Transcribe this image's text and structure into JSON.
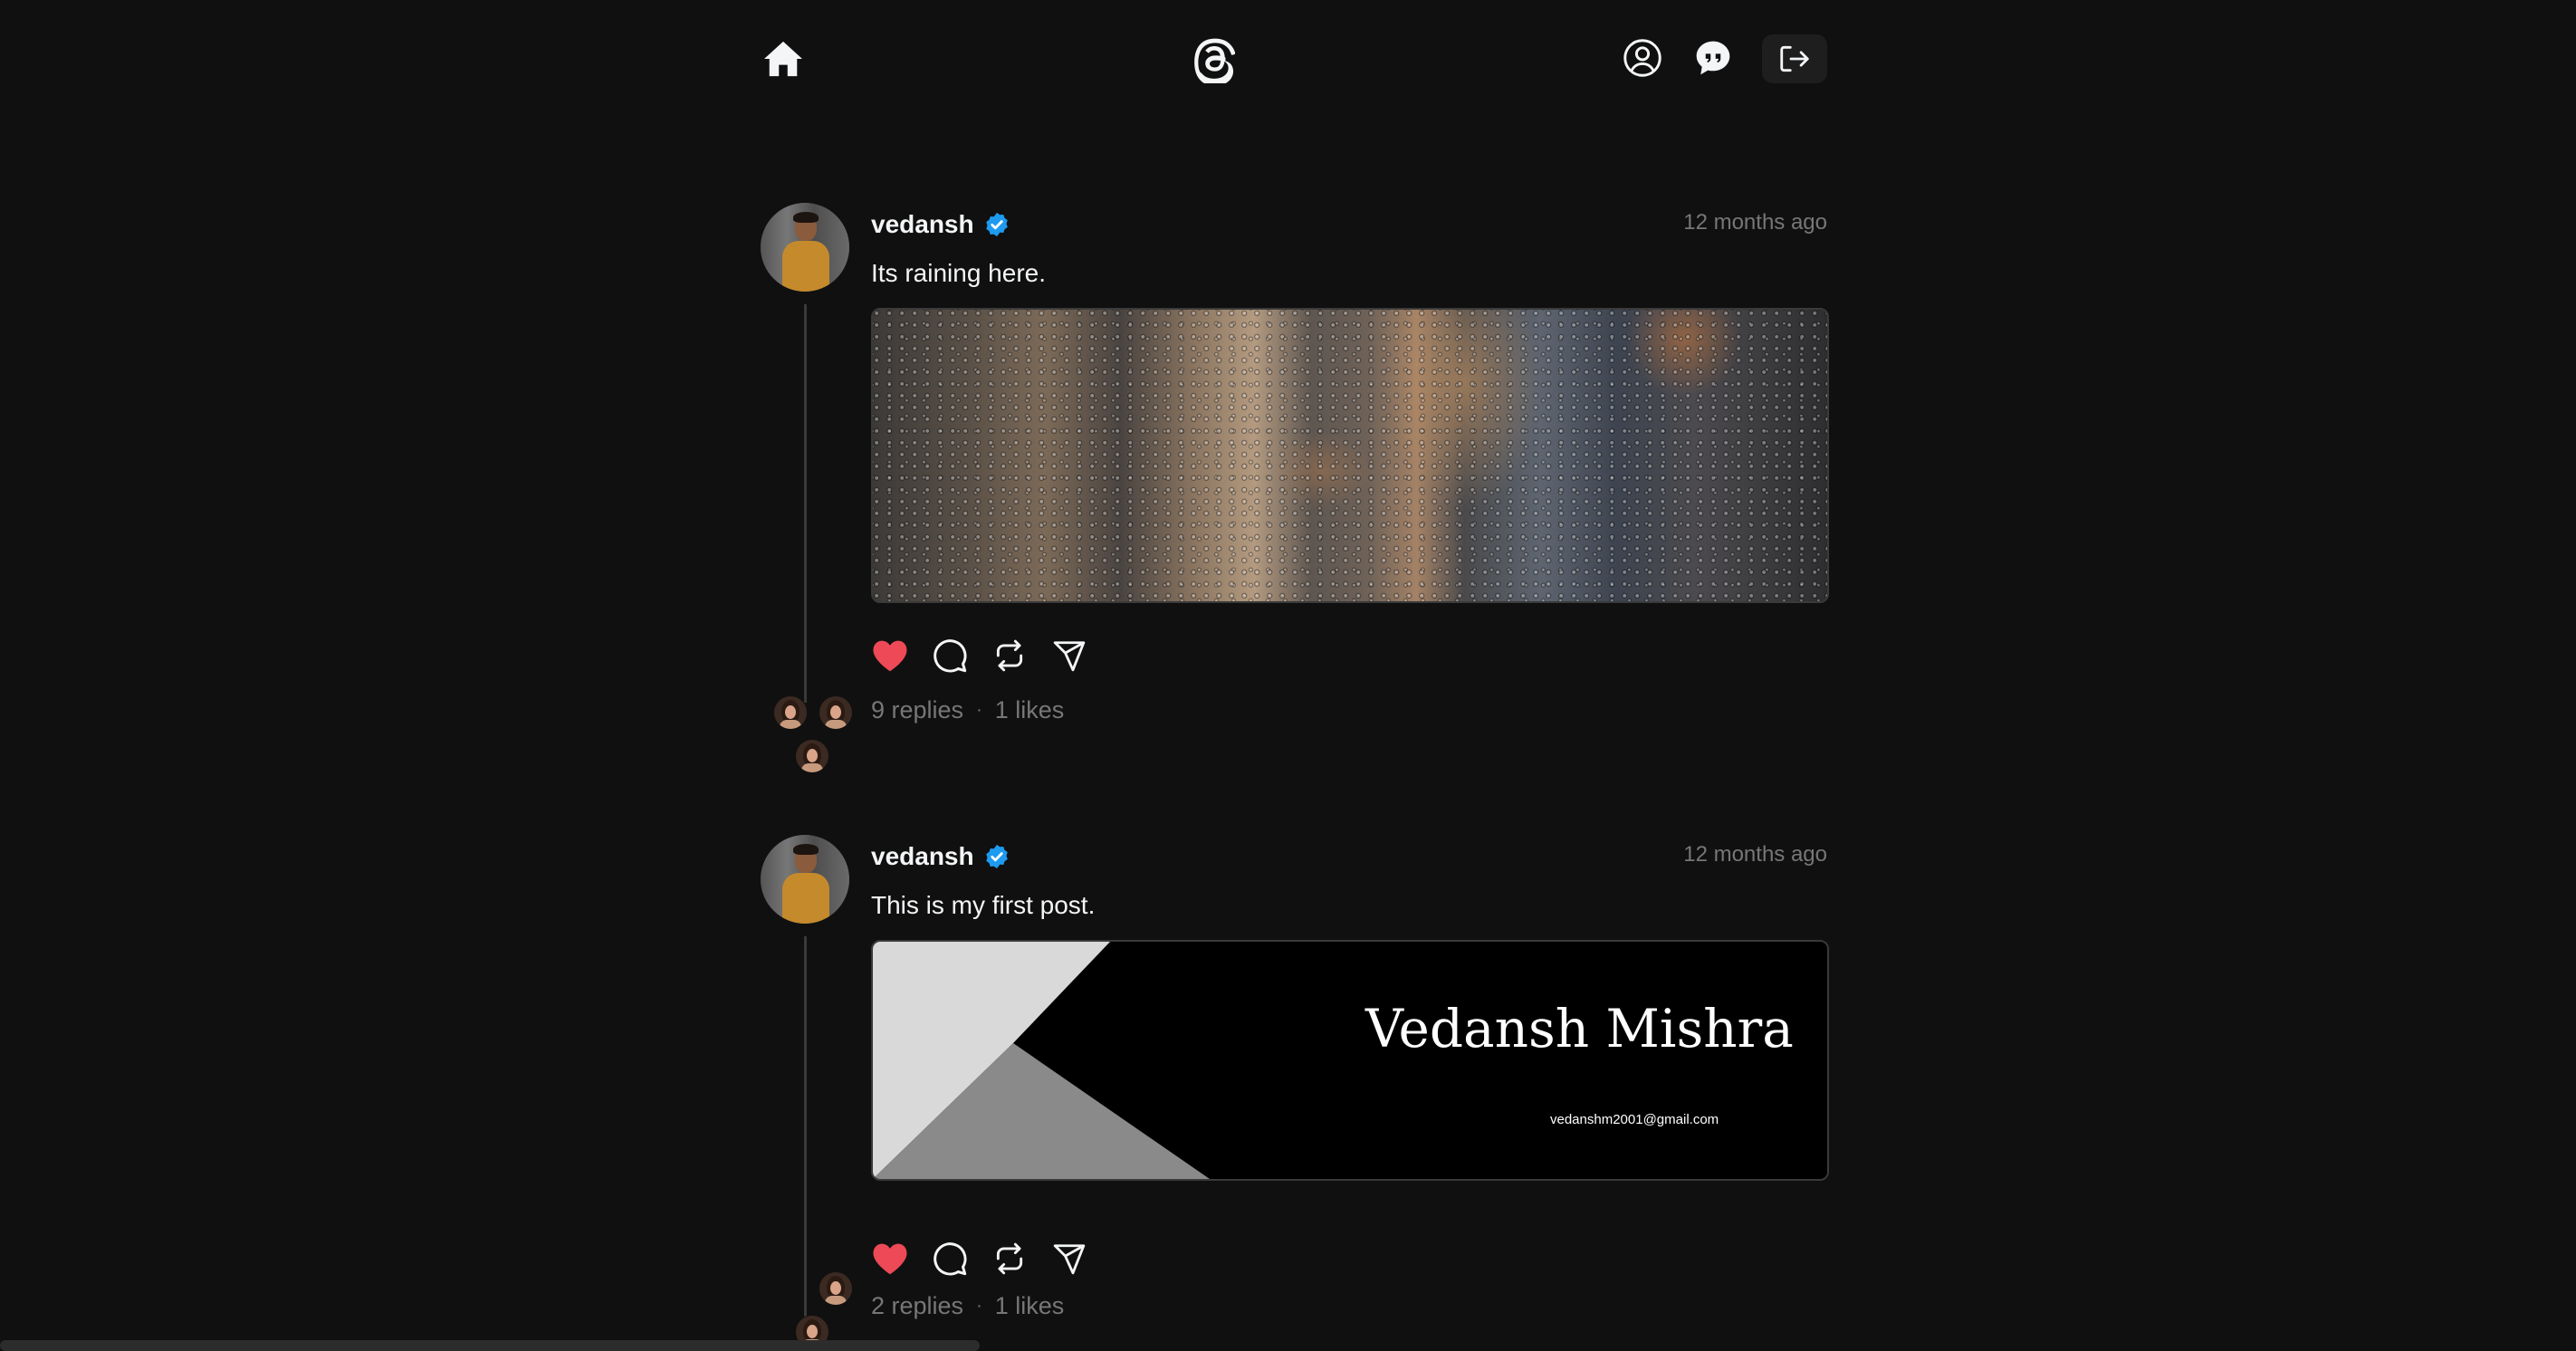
{
  "header": {
    "icons": [
      "home-icon",
      "threads-logo",
      "profile-icon",
      "chat-icon",
      "logout-icon"
    ]
  },
  "posts": [
    {
      "username": "vedansh",
      "verified": true,
      "timestamp": "12 months ago",
      "text": "Its raining here.",
      "image": "rainy-window-photo",
      "liked": true,
      "replies": "9 replies",
      "likes": "1 likes"
    },
    {
      "username": "vedansh",
      "verified": true,
      "timestamp": "12 months ago",
      "text": "This is my first post.",
      "image": "name-banner",
      "banner_name": "Vedansh Mishra",
      "banner_email": "vedanshm2001@gmail.com",
      "liked": true,
      "replies": "2 replies",
      "likes": "1 likes"
    }
  ],
  "stats_separator": "·",
  "colors": {
    "background": "#101010",
    "text": "#f3f5f7",
    "muted": "#777777",
    "like": "#ed4956",
    "verified": "#1d9bf0"
  }
}
